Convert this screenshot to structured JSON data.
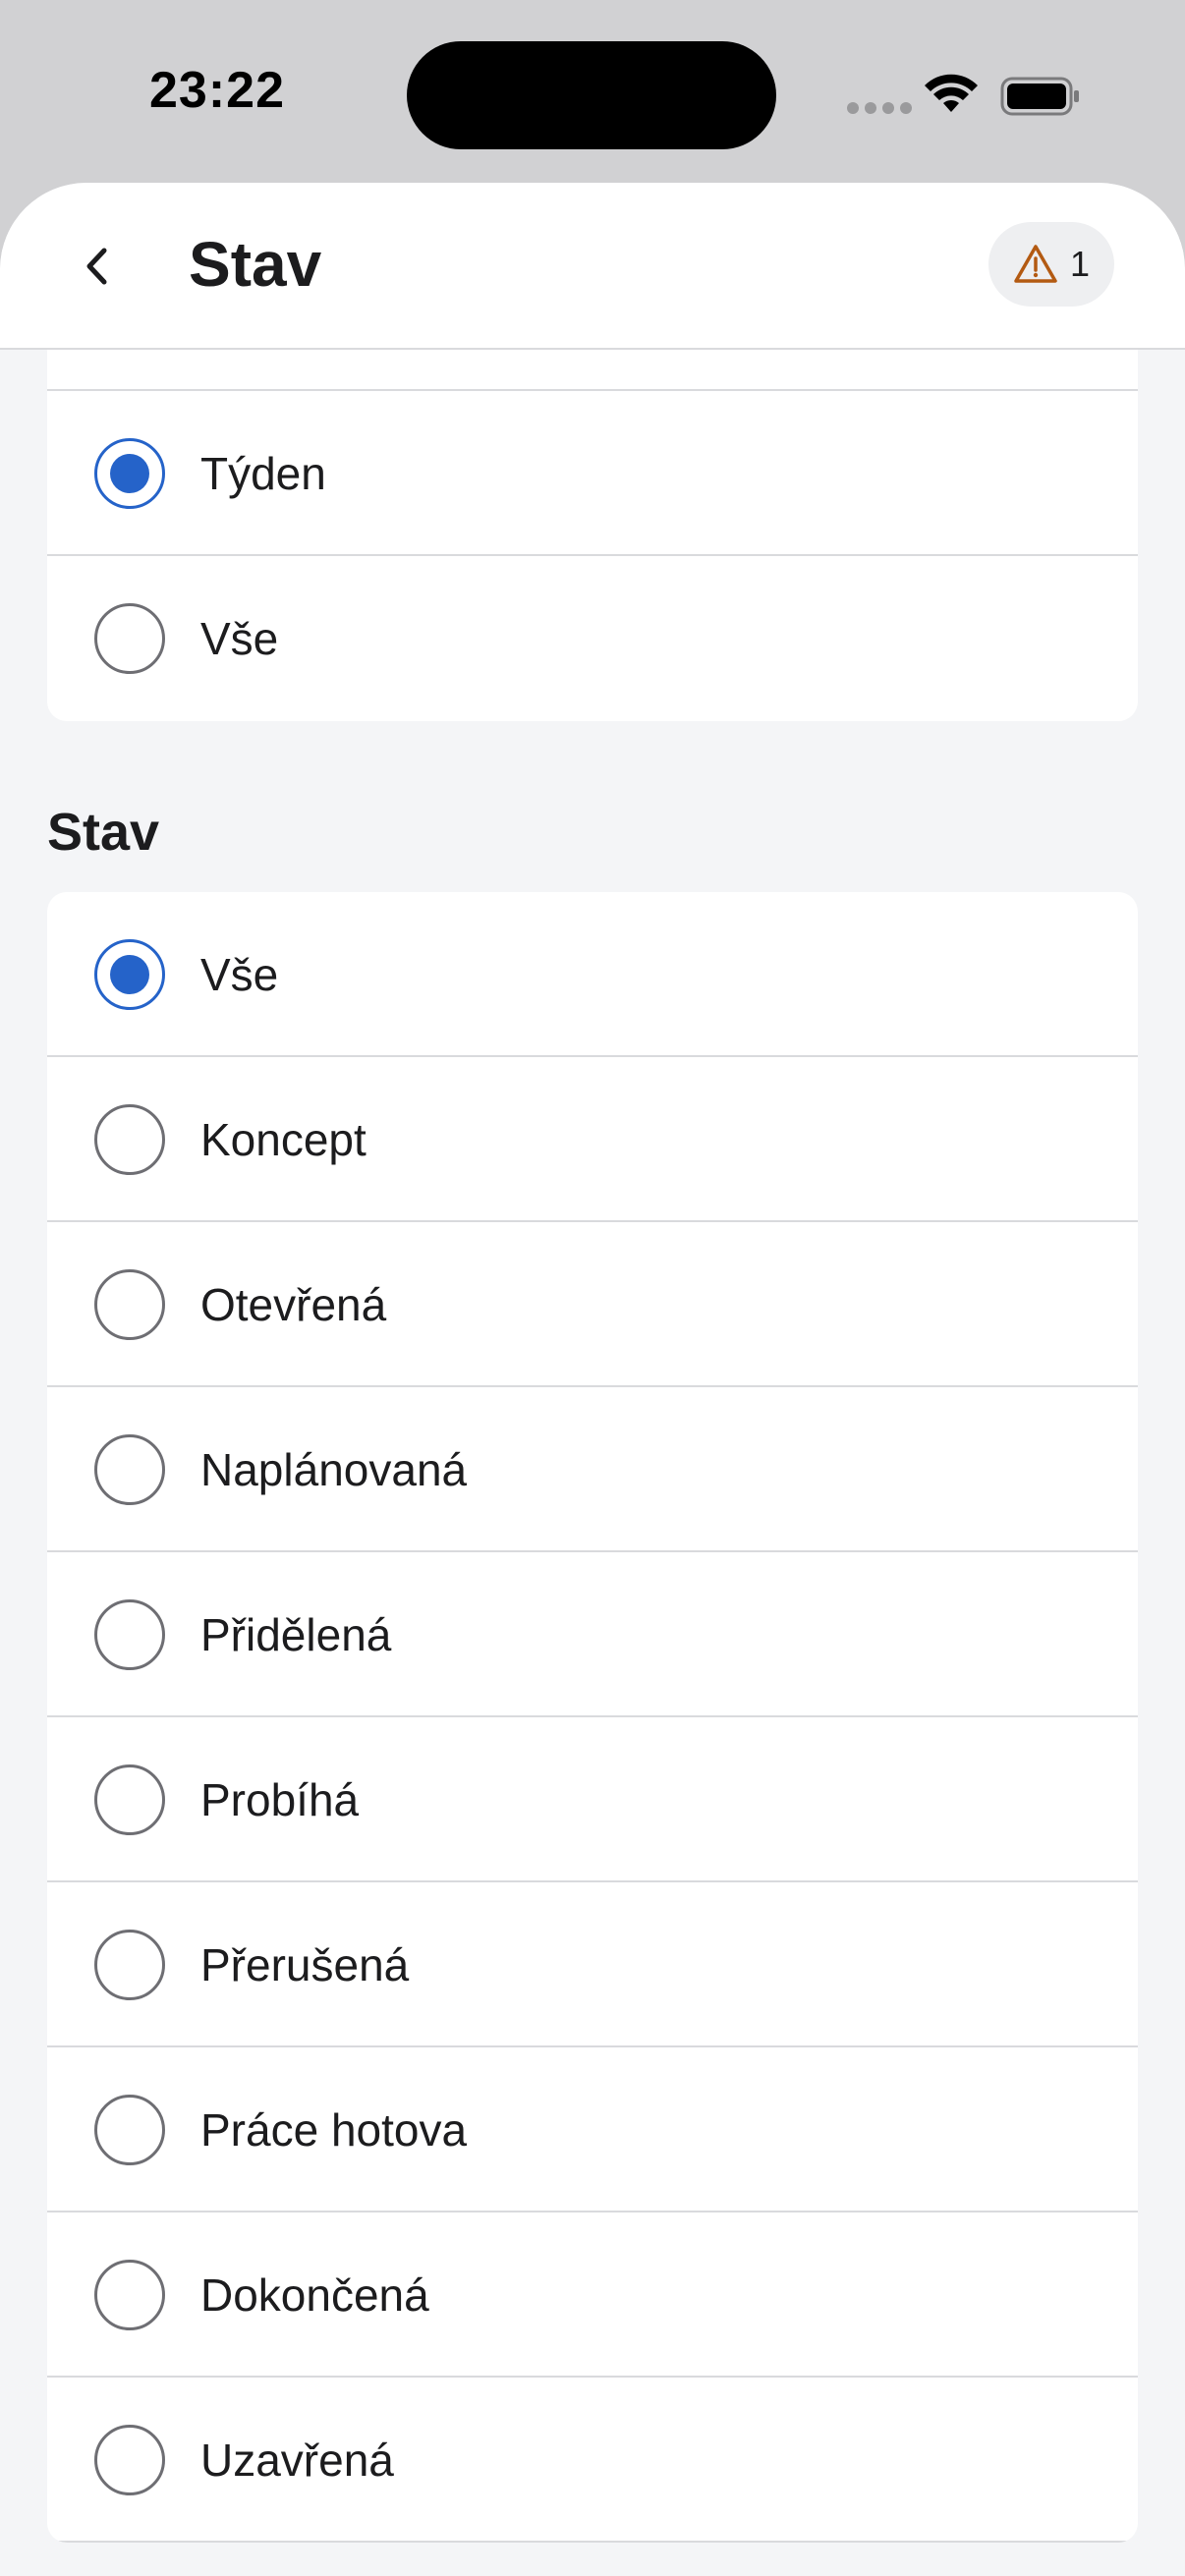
{
  "status_bar": {
    "time": "23:22"
  },
  "header": {
    "title": "Stav",
    "warning_count": "1"
  },
  "period_options": [
    {
      "label": "Týden",
      "selected": true
    },
    {
      "label": "Vše",
      "selected": false
    }
  ],
  "status_section": {
    "title": "Stav",
    "options": [
      {
        "label": "Vše",
        "selected": true
      },
      {
        "label": "Koncept",
        "selected": false
      },
      {
        "label": "Otevřená",
        "selected": false
      },
      {
        "label": "Naplánovaná",
        "selected": false
      },
      {
        "label": "Přidělená",
        "selected": false
      },
      {
        "label": "Probíhá",
        "selected": false
      },
      {
        "label": "Přerušená",
        "selected": false
      },
      {
        "label": "Práce hotova",
        "selected": false
      },
      {
        "label": "Dokončená",
        "selected": false
      },
      {
        "label": "Uzavřená",
        "selected": false
      }
    ]
  },
  "colors": {
    "accent": "#2563c9",
    "warning": "#b35a12",
    "background": "#f4f5f7"
  }
}
